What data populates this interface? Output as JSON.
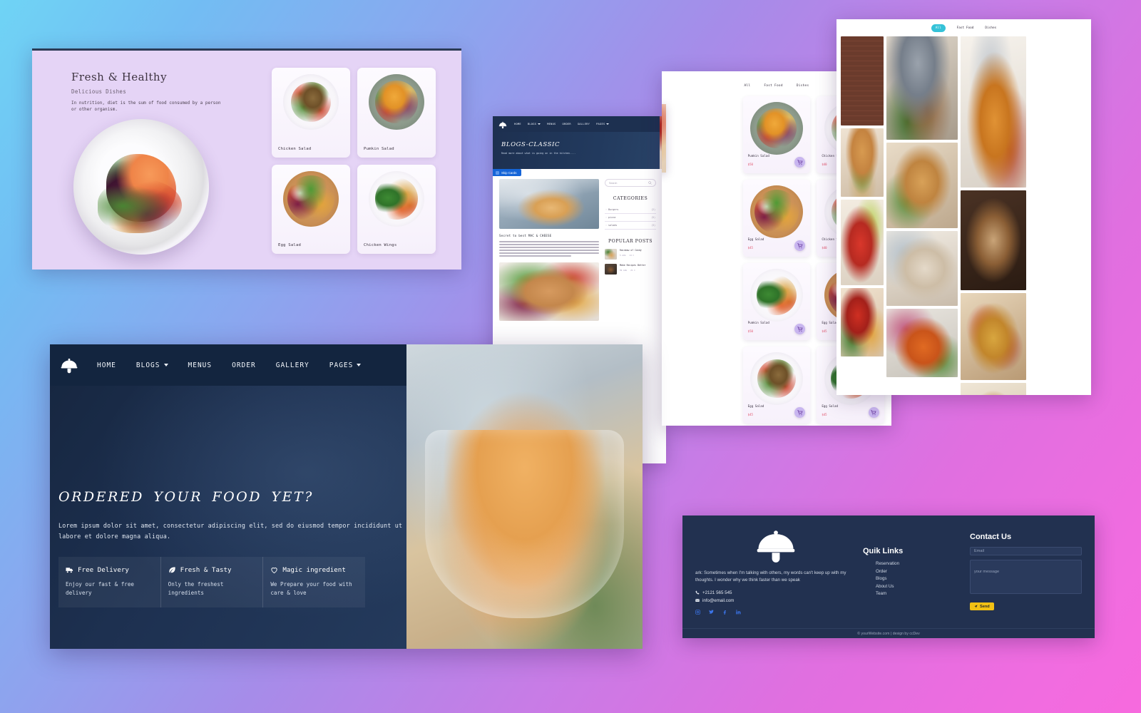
{
  "background": {
    "gradient_from": "#6fd4f5",
    "gradient_to": "#f76ade"
  },
  "fresh_panel": {
    "title": "Fresh & Healthy",
    "subtitle": "Delicious Dishes",
    "description": "In nutrition, diet is the sum of food consumed by a person or other organism.",
    "dishes": [
      {
        "name": "Chicken Salad",
        "art": "art-chickensalad"
      },
      {
        "name": "Pumkin Salad",
        "art": "art-pumkinsalad"
      },
      {
        "name": "Egg Salad",
        "art": "art-eggsalad"
      },
      {
        "name": "Chicken Wings",
        "art": "art-chickenwings"
      }
    ]
  },
  "blog_panel": {
    "nav": [
      "HOME",
      "BLOGS",
      "MENUS",
      "ORDER",
      "GALLERY",
      "PAGES"
    ],
    "hero_title": "BLOGS-CLASSIC",
    "hero_subtitle": "Read more about what is going on in the kitchen....",
    "chip_label": "Skip Cards",
    "post_title": "Secret to best MAC & CHEESE",
    "search_placeholder": "Search",
    "categories_heading": "CATEGORIES",
    "categories": [
      {
        "label": "Burgers",
        "count": "(2)"
      },
      {
        "label": "pizza",
        "count": "(5)"
      },
      {
        "label": "salads",
        "count": "(3)"
      }
    ],
    "popular_heading": "POPULAR POSTS",
    "popular_posts": [
      {
        "title": "Rainbow of Candy",
        "date": "5 AUG",
        "comments": "14 C"
      },
      {
        "title": "Make Recipes Better",
        "date": "09 AUG",
        "comments": "21 C"
      }
    ]
  },
  "menu_panel": {
    "tabs": [
      "All",
      "Fast Food",
      "Dishes"
    ],
    "active_tab": "All",
    "products": [
      {
        "name": "Pumkin Salad",
        "price": "$50",
        "art": "art-pumkinsalad"
      },
      {
        "name": "Chicken Salad",
        "price": "$40",
        "art": "art-chickensalad"
      },
      {
        "name": "Egg Salad",
        "price": "$45",
        "art": "art-eggsalad"
      },
      {
        "name": "Chicken Salad",
        "price": "$40",
        "art": "art-chickensalad"
      },
      {
        "name": "Pumkin Salad",
        "price": "$50",
        "art": "art-chickenwings"
      },
      {
        "name": "Egg Salad",
        "price": "$45",
        "art": "art-eggsalad"
      },
      {
        "name": "Egg Salad",
        "price": "$45",
        "art": "art-chickensalad"
      },
      {
        "name": "Egg Salad",
        "price": "$45",
        "art": "art-chickenwings"
      }
    ],
    "cart_icon": "shopping-cart-icon"
  },
  "gallery_panel": {
    "tabs": [
      "All",
      "Fast Food",
      "Dishes"
    ],
    "active_tab": "All",
    "accent_color": "#35c2d8",
    "images": [
      "brick-wall",
      "burger",
      "drink",
      "tomato-pasta",
      "chef-plating",
      "sandwich",
      "table-setting",
      "soup-bowl",
      "spaghetti-fork",
      "latte-art",
      "pizza",
      "cutlet-platter"
    ]
  },
  "hero_panel": {
    "nav": [
      "HOME",
      "BLOGS",
      "MENUS",
      "ORDER",
      "GALLERY",
      "PAGES"
    ],
    "nav_with_caret": [
      "BLOGS",
      "PAGES"
    ],
    "title": "ORDERED YOUR FOOD YET?",
    "paragraph": "Lorem ipsum dolor sit amet, consectetur adipiscing elit, sed do eiusmod tempor incididunt ut labore et dolore magna aliqua.",
    "features": [
      {
        "icon": "truck-icon",
        "title": "Free Delivery",
        "desc": "Enjoy our fast & free delivery"
      },
      {
        "icon": "leaf-icon",
        "title": "Fresh & Tasty",
        "desc": "Only the freshest ingredients"
      },
      {
        "icon": "heart-icon",
        "title": "Magic ingredient",
        "desc": "We Prepare your food with care & love"
      }
    ]
  },
  "footer_panel": {
    "logo_icon": "cloche-serving-icon",
    "about": "ark: Sometimes when I'm talking with others, my words can't keep up with my thoughts. I wonder why we think faster than we speak",
    "phone": "+2121 565 545",
    "email": "info@email.com",
    "social": [
      "instagram-icon",
      "twitter-icon",
      "facebook-icon",
      "linkedin-icon"
    ],
    "quick_links_heading": "Quik Links",
    "quick_links": [
      "Reservation",
      "Order",
      "Blogs",
      "About Us",
      "Team"
    ],
    "contact_heading": "Contact Us",
    "email_placeholder": "Email",
    "message_placeholder": "your message",
    "send_label": "Send",
    "send_color": "#f2c014",
    "copyright": "© yourWebsite.com | design by ccDev"
  }
}
